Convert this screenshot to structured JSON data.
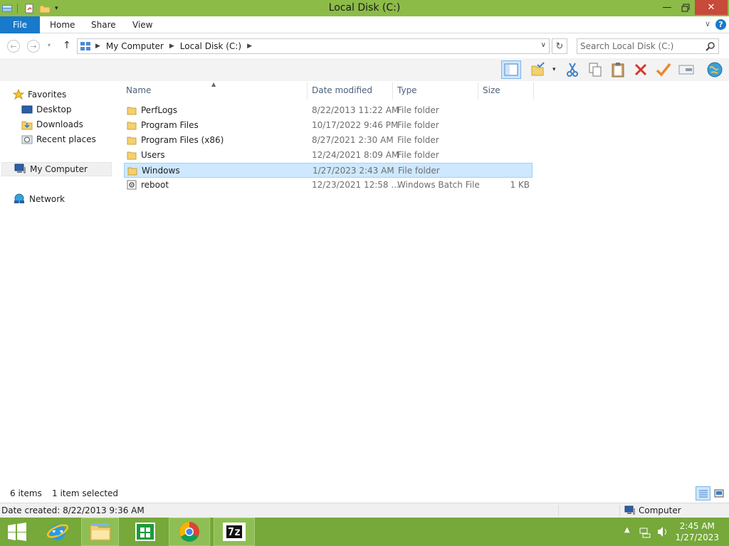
{
  "window": {
    "title": "Local Disk (C:)",
    "minimize_icon": "minimize-icon",
    "maximize_icon": "restore-icon",
    "close_label": "✕",
    "accent": "#8cbb48"
  },
  "ribbon": {
    "file_tab": "File",
    "tabs": [
      "Home",
      "Share",
      "View"
    ],
    "help": "?",
    "file_tab_color": "#1979ca"
  },
  "navigation": {
    "breadcrumbs": [
      "My Computer",
      "Local Disk (C:)"
    ],
    "search_placeholder": "Search Local Disk (C:)"
  },
  "sidebar": {
    "favorites": {
      "label": "Favorites",
      "items": [
        "Desktop",
        "Downloads",
        "Recent places"
      ]
    },
    "computer": "My Computer",
    "network": "Network"
  },
  "file_list": {
    "columns": [
      "Name",
      "Date modified",
      "Type",
      "Size"
    ],
    "rows": [
      {
        "name": "PerfLogs",
        "date": "8/22/2013 11:22 AM",
        "type": "File folder",
        "size": "",
        "icon": "folder-icon"
      },
      {
        "name": "Program Files",
        "date": "10/17/2022 9:46 PM",
        "type": "File folder",
        "size": "",
        "icon": "folder-icon"
      },
      {
        "name": "Program Files (x86)",
        "date": "8/27/2021 2:30 AM",
        "type": "File folder",
        "size": "",
        "icon": "folder-icon"
      },
      {
        "name": "Users",
        "date": "12/24/2021 8:09 AM",
        "type": "File folder",
        "size": "",
        "icon": "folder-icon"
      },
      {
        "name": "Windows",
        "date": "1/27/2023 2:43 AM",
        "type": "File folder",
        "size": "",
        "icon": "folder-icon",
        "selected": true
      },
      {
        "name": "reboot",
        "date": "12/23/2021 12:58 ...",
        "type": "Windows Batch File",
        "size": "1 KB",
        "icon": "batch-file-icon"
      }
    ]
  },
  "status": {
    "item_count": "6 items",
    "selection": "1 item selected",
    "date_created": "Date created: 8/22/2013 9:36 AM",
    "location": "Computer"
  },
  "taskbar": {
    "time": "2:45 AM",
    "date": "1/27/2023",
    "seven_zip_label": "7z",
    "color": "#76a83a"
  }
}
